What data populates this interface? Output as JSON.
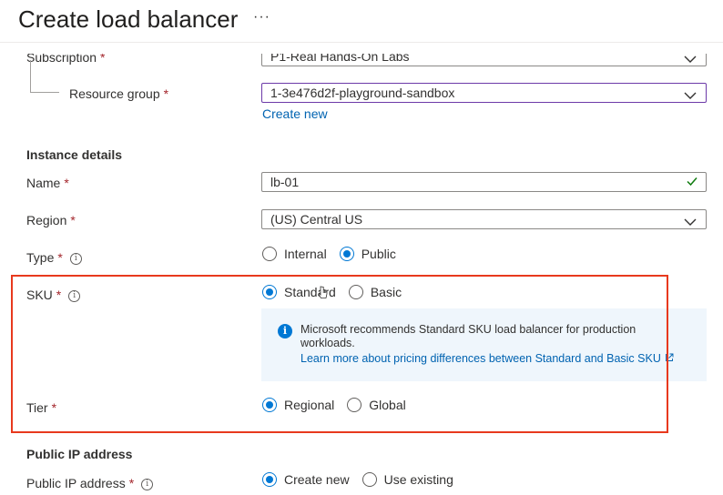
{
  "page": {
    "title": "Create load balancer",
    "more_label": "···"
  },
  "project": {
    "subscription_label": "Subscription",
    "subscription_value": "P1-Real Hands-On Labs",
    "resource_group_label": "Resource group",
    "resource_group_value": "1-3e476d2f-playground-sandbox",
    "create_new_link": "Create new",
    "required_marker": "*"
  },
  "instance": {
    "section_title": "Instance details",
    "name_label": "Name",
    "name_value": "lb-01",
    "region_label": "Region",
    "region_value": "(US) Central US",
    "type_label": "Type",
    "type_options": [
      "Internal",
      "Public"
    ],
    "type_selected": "Public",
    "sku_label": "SKU",
    "sku_options": [
      "Standard",
      "Basic"
    ],
    "sku_selected": "Standard",
    "sku_info_message": "Microsoft recommends Standard SKU load balancer for production workloads.",
    "sku_info_link": "Learn more about pricing differences between Standard and Basic SKU",
    "tier_label": "Tier",
    "tier_options": [
      "Regional",
      "Global"
    ],
    "tier_selected": "Regional"
  },
  "public_ip": {
    "section_title": "Public IP address",
    "label": "Public IP address",
    "options": [
      "Create new",
      "Use existing"
    ],
    "selected": "Create new"
  },
  "icons": {
    "info": "info-circle-icon",
    "chevron": "chevron-down-icon",
    "valid": "checkmark-icon",
    "external": "external-link-icon",
    "cursor": "mouse-cursor-icon"
  },
  "colors": {
    "accent": "#0078d4",
    "link": "#0063b1",
    "required": "#a4262c",
    "highlight_border": "#e8391d",
    "info_background": "#eff6fc",
    "valid_check": "#107c10",
    "focused_border": "#6c3aa8"
  }
}
